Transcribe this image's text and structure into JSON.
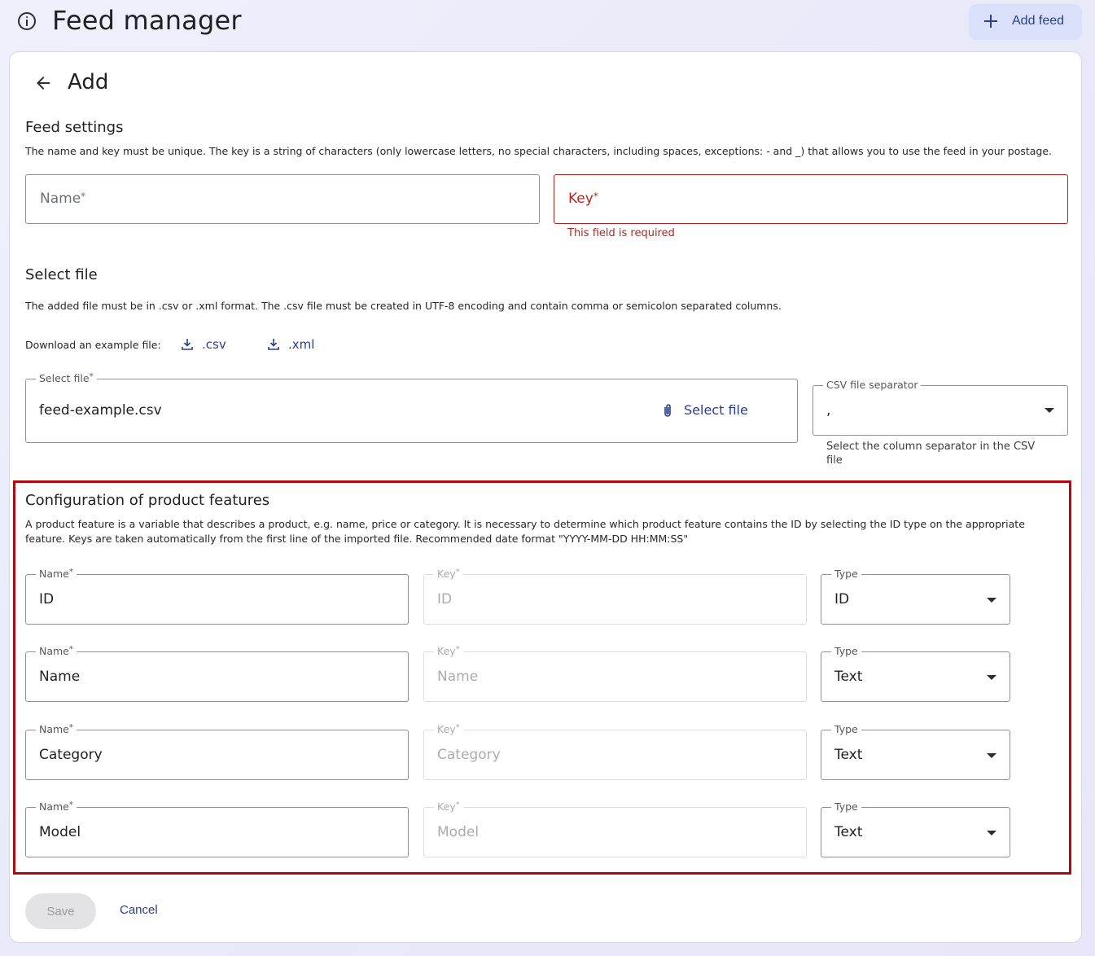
{
  "header": {
    "title": "Feed manager",
    "add_feed_label": "Add feed",
    "info_icon": "info-icon"
  },
  "page": {
    "title": "Add"
  },
  "feed_settings": {
    "title": "Feed settings",
    "description": "The name and key must be unique. The key is a string of characters (only lowercase letters, no special characters, including spaces, exceptions: - and _) that allows you to use the feed in your postage.",
    "name_placeholder": "Name",
    "key_placeholder": "Key",
    "required_mark": "*",
    "key_error": "This field is required"
  },
  "select_file": {
    "title": "Select file",
    "description": "The added file must be in .csv or .xml format. The .csv file must be created in UTF-8 encoding and contain comma or semicolon separated columns.",
    "download_label": "Download an example file:",
    "csv_link": ".csv",
    "xml_link": ".xml",
    "file_label": "Select file",
    "file_value": "feed-example.csv",
    "select_file_button": "Select file",
    "separator_label": "CSV file separator",
    "separator_value": ",",
    "separator_helper": "Select the column separator in the CSV file"
  },
  "features": {
    "title": "Configuration of product features",
    "description": "A product feature is a variable that describes a product, e.g. name, price or category. It is necessary to determine which product feature contains the ID by selecting the ID type on the appropriate feature. Keys are taken automatically from the first line of the imported file. Recommended date format \"YYYY-MM-DD HH:MM:SS\"",
    "name_label": "Name",
    "key_label": "Key",
    "type_label": "Type",
    "rows": [
      {
        "name": "ID",
        "key": "ID",
        "type": "ID"
      },
      {
        "name": "Name",
        "key": "Name",
        "type": "Text"
      },
      {
        "name": "Category",
        "key": "Category",
        "type": "Text"
      },
      {
        "name": "Model",
        "key": "Model",
        "type": "Text"
      }
    ]
  },
  "actions": {
    "save_label": "Save",
    "cancel_label": "Cancel"
  },
  "colors": {
    "accent": "#2b3f8a",
    "error": "#b3261e",
    "highlight": "#b00a10"
  }
}
